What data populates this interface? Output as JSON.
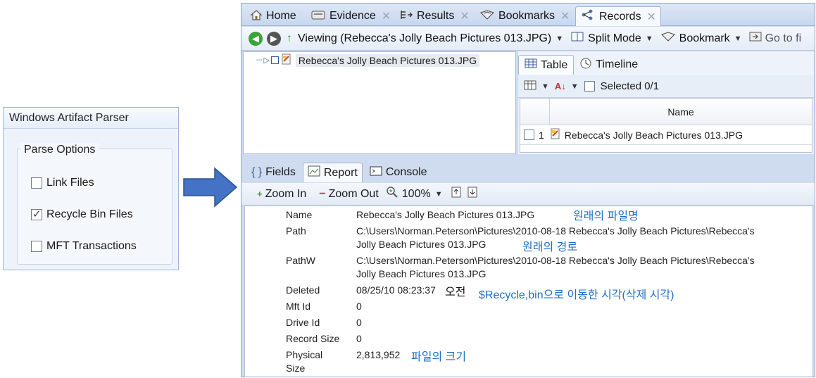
{
  "left_panel": {
    "title": "Windows Artifact Parser",
    "group_label": "Parse Options",
    "options": [
      {
        "label": "Link Files",
        "checked": false
      },
      {
        "label": "Recycle Bin Files",
        "checked": true
      },
      {
        "label": "MFT Transactions",
        "checked": false
      }
    ]
  },
  "tabs": [
    {
      "label": "Home",
      "icon": "home-icon"
    },
    {
      "label": "Evidence",
      "icon": "evidence-icon"
    },
    {
      "label": "Results",
      "icon": "results-icon"
    },
    {
      "label": "Bookmarks",
      "icon": "bookmarks-icon"
    },
    {
      "label": "Records",
      "icon": "records-icon",
      "active": true
    }
  ],
  "toolbar": {
    "viewing": "Viewing (Rebecca's Jolly Beach Pictures 013.JPG)",
    "split_mode": "Split Mode",
    "bookmark": "Bookmark",
    "goto": "Go to fi"
  },
  "tree": {
    "item": "Rebecca's Jolly Beach Pictures 013.JPG"
  },
  "right_pane": {
    "tab_table": "Table",
    "tab_timeline": "Timeline",
    "selected": "Selected 0/1",
    "column_name": "Name",
    "row_index": "1",
    "row_name": "Rebecca's Jolly Beach Pictures 013.JPG"
  },
  "bottom_tabs": {
    "fields": "Fields",
    "report": "Report",
    "console": "Console"
  },
  "bottom_toolbar": {
    "zoom_in": "Zoom In",
    "zoom_out": "Zoom Out",
    "zoom_level": "100%"
  },
  "report": {
    "name_label": "Name",
    "name_value": "Rebecca's Jolly Beach Pictures 013.JPG",
    "path_label": "Path",
    "path_value_1": "C:\\Users\\Norman.Peterson\\Pictures\\2010-08-18 Rebecca's Jolly Beach Pictures\\Rebecca's",
    "path_value_2": "Jolly Beach Pictures 013.JPG",
    "pathw_label": "PathW",
    "pathw_value_1": "C:\\Users\\Norman.Peterson\\Pictures\\2010-08-18 Rebecca's Jolly Beach Pictures\\Rebecca's",
    "pathw_value_2": "Jolly Beach Pictures 013.JPG",
    "deleted_label": "Deleted",
    "deleted_value": "08/25/10 08:23:37",
    "deleted_ampm": "오전",
    "mftid_label": "Mft Id",
    "mftid_value": "0",
    "driveid_label": "Drive Id",
    "driveid_value": "0",
    "recordsize_label": "Record Size",
    "recordsize_value": "0",
    "physical_label_1": "Physical",
    "physical_label_2": "Size",
    "physical_value": "2,813,952"
  },
  "annotations": {
    "original_filename": "원래의 파일명",
    "original_path": "원래의 경로",
    "deleted_time": "$Recycle,bin으로 이동한 시각(삭제 시각)",
    "file_size": "파일의 크기"
  },
  "colors": {
    "annotation": "#1f6fc5",
    "arrow": "#4472c4",
    "window_bg": "#cfdcef"
  }
}
